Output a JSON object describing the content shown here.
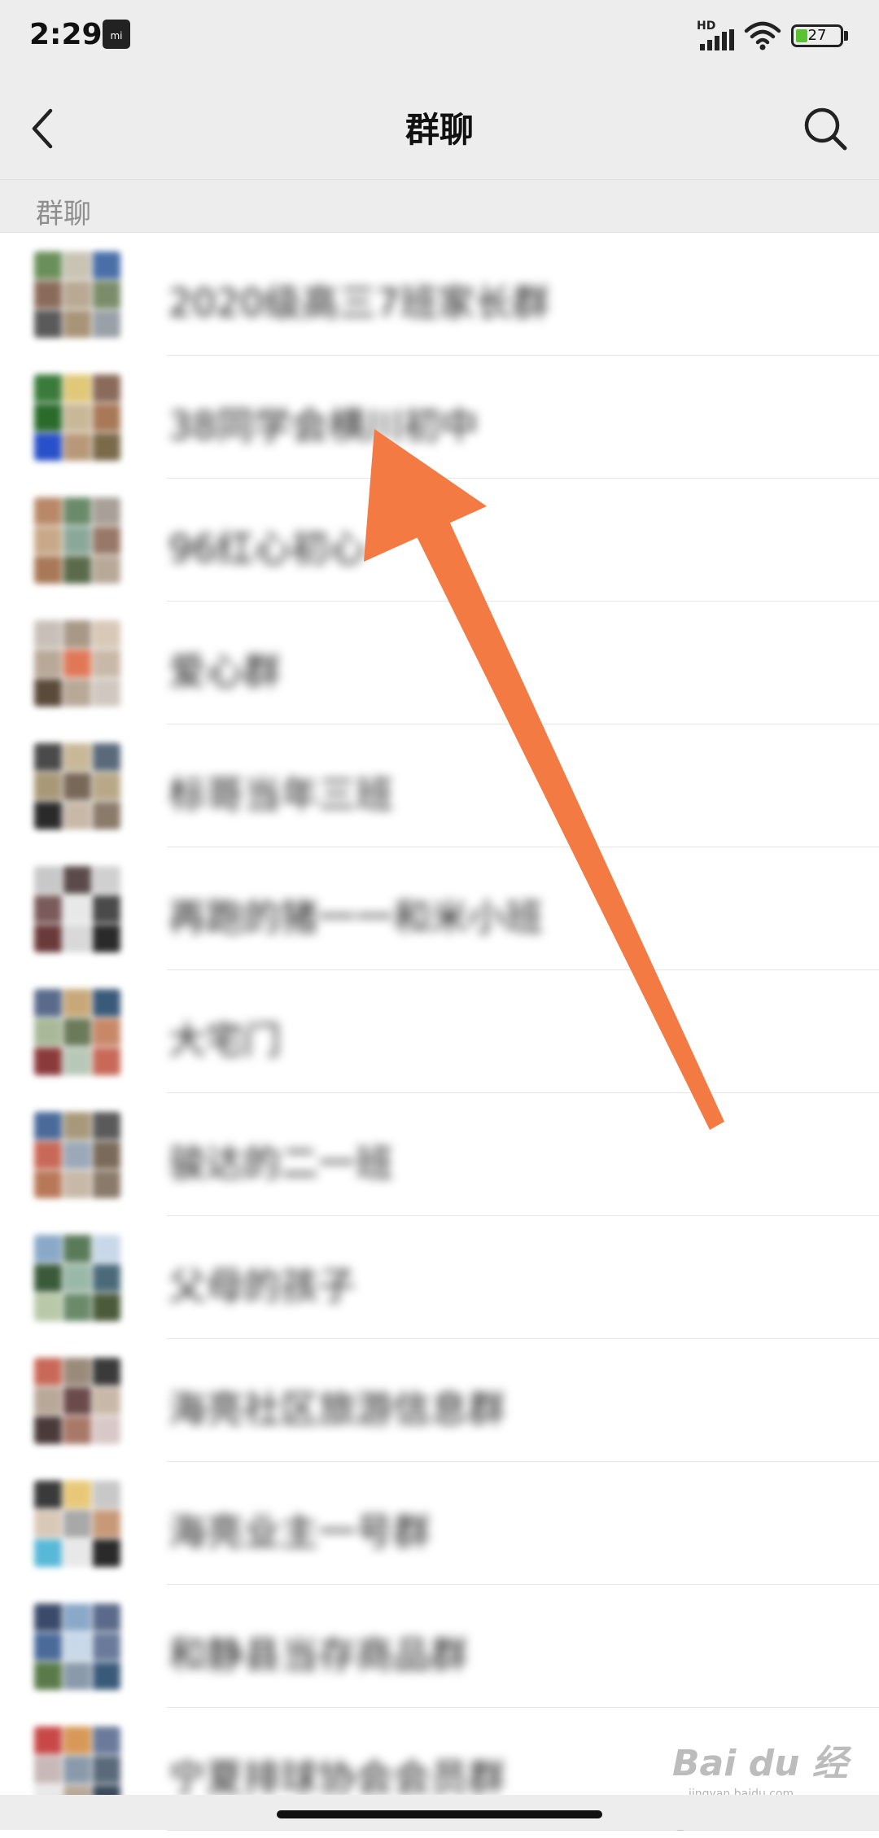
{
  "status_bar": {
    "time": "2:29",
    "hd_label": "HD",
    "battery_level": "27",
    "battery_percent": 27,
    "icons": [
      "mi-notification-icon",
      "signal-icon",
      "wifi-icon",
      "battery-icon"
    ]
  },
  "nav": {
    "title": "群聊",
    "back_icon": "chevron-left-icon",
    "search_icon": "search-icon"
  },
  "section": {
    "label": "群聊"
  },
  "groups": [
    {
      "name": "2020级高三7班家长群",
      "colors": [
        "#6a8f5a",
        "#c9c3b4",
        "#4a6fa8",
        "#8a6b5a",
        "#b8a894",
        "#7a8c6a",
        "#5a5a5a",
        "#a89478",
        "#9aa0a8"
      ]
    },
    {
      "name": "38同学会横川初中",
      "colors": [
        "#3a7a3a",
        "#e0c878",
        "#8a6a5a",
        "#2a6a2a",
        "#c8b898",
        "#a87858",
        "#2850c8",
        "#b89878",
        "#7a6a4a"
      ]
    },
    {
      "name": "96红心初心",
      "colors": [
        "#b88868",
        "#6a8a6a",
        "#a8a098",
        "#c8a888",
        "#8aa89a",
        "#987868",
        "#a87858",
        "#5a6a4a",
        "#b8a898"
      ]
    },
    {
      "name": "爱心群",
      "colors": [
        "#c8c0b8",
        "#a89888",
        "#d8c8b8",
        "#b8a898",
        "#e07858",
        "#c8b8a8",
        "#5a4a3a",
        "#b8a898",
        "#d0c8c0"
      ]
    },
    {
      "name": "标哥当年三班",
      "colors": [
        "#4a4a4a",
        "#c8b898",
        "#5a6a7a",
        "#a89878",
        "#786858",
        "#b8a888",
        "#2a2a2a",
        "#c8b8a8",
        "#8a7a6a"
      ]
    },
    {
      "name": "再跑的猪一一和米小班",
      "colors": [
        "#c8c8c8",
        "#5a4a4a",
        "#d0d0d0",
        "#7a5a5a",
        "#e8e8e8",
        "#4a4a4a",
        "#6a3a3a",
        "#d8d8d8",
        "#2a2a2a"
      ]
    },
    {
      "name": "大宅门",
      "colors": [
        "#5a6a8a",
        "#c8a878",
        "#3a5a7a",
        "#a8b898",
        "#6a7a5a",
        "#c88868",
        "#8a3a3a",
        "#b8c8b8",
        "#c86858"
      ]
    },
    {
      "name": "骏达的二一班",
      "colors": [
        "#4a6a9a",
        "#a8987a",
        "#5a5a5a",
        "#c86858",
        "#9aa8b8",
        "#7a6a5a",
        "#b87858",
        "#c8b8a8",
        "#8a7a6a"
      ]
    },
    {
      "name": "父母的孩子",
      "colors": [
        "#8aa8c8",
        "#5a7a5a",
        "#c8d8e8",
        "#3a5a3a",
        "#9ab8a8",
        "#4a6a7a",
        "#b8c8a8",
        "#6a8a6a",
        "#4a5a3a"
      ]
    },
    {
      "name": "海亮社区旅游信息群",
      "colors": [
        "#c86858",
        "#9a8a7a",
        "#3a3a3a",
        "#b8a898",
        "#6a4a4a",
        "#c8b8a8",
        "#4a3a3a",
        "#a87868",
        "#d8c8c8"
      ]
    },
    {
      "name": "海亮业主一号群",
      "colors": [
        "#3a3a3a",
        "#e8c878",
        "#c8c8c8",
        "#d8c8b8",
        "#a8a8a8",
        "#c89878",
        "#58b8d8",
        "#e8e8e8",
        "#2a2a2a"
      ]
    },
    {
      "name": "和静县当存商品群",
      "colors": [
        "#3a4a6a",
        "#8aa8c8",
        "#5a6a8a",
        "#4a6a9a",
        "#c8d8e8",
        "#6a7a9a",
        "#5a7a4a",
        "#8a9aaa",
        "#3a5a7a"
      ]
    },
    {
      "name": "宁夏排球协会会员群",
      "colors": [
        "#c84848",
        "#d89858",
        "#6a7a9a",
        "#c8b8b8",
        "#8a9aaa",
        "#5a6a7a",
        "#e8e8e8",
        "#b8a898",
        "#3a4a5a"
      ]
    }
  ],
  "watermark": {
    "text": "Bai du 经验",
    "url_text": "jingyan.baidu.com"
  }
}
